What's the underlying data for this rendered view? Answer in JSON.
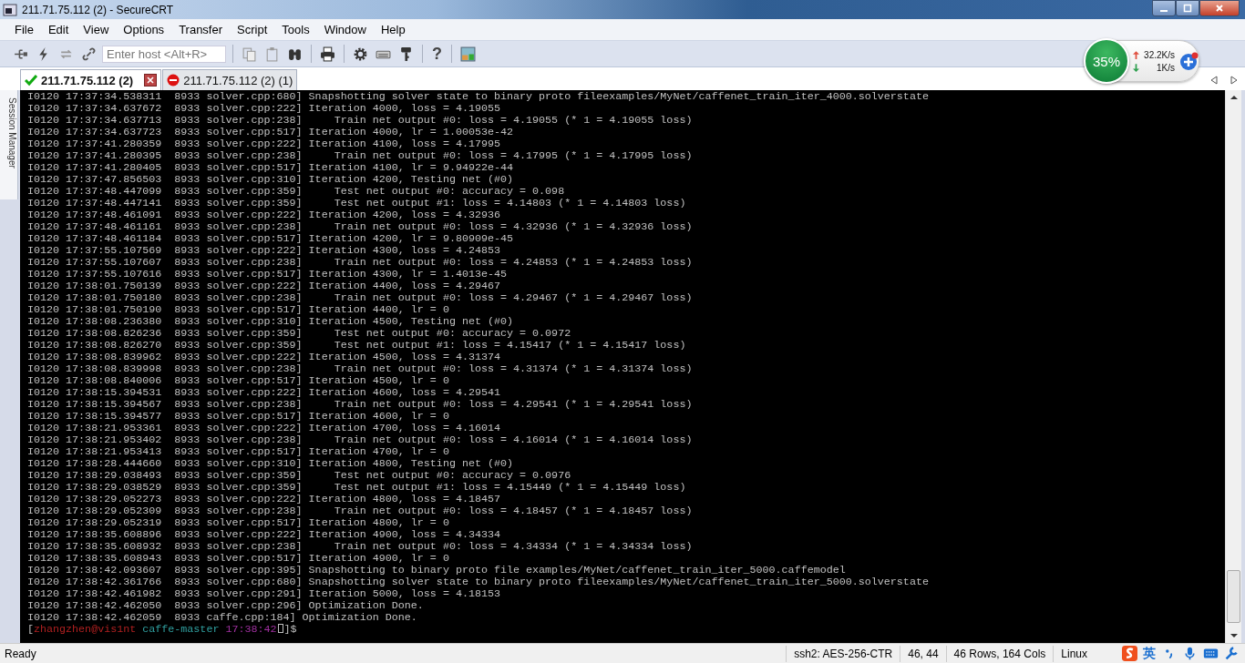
{
  "window": {
    "title": "211.71.75.112 (2) - SecureCRT"
  },
  "menu": [
    "File",
    "Edit",
    "View",
    "Options",
    "Transfer",
    "Script",
    "Tools",
    "Window",
    "Help"
  ],
  "toolbar": {
    "host_field": {
      "placeholder": "Enter host <Alt+R>"
    },
    "help_label": "?"
  },
  "tabs": [
    {
      "label": "211.71.75.112 (2)",
      "selected": true,
      "kind": "connected"
    },
    {
      "label": "211.71.75.112 (2) (1)",
      "selected": false,
      "kind": "disconnected"
    }
  ],
  "session_manager": {
    "label": "Session Manager"
  },
  "network_widget": {
    "percent": "35%",
    "upload": "32.2K/s",
    "download": "1K/s"
  },
  "terminal": {
    "lines": [
      "I0120 17:37:34.538311  8933 solver.cpp:680] Snapshotting solver state to binary proto fileexamples/MyNet/caffenet_train_iter_4000.solverstate",
      "I0120 17:37:34.637672  8933 solver.cpp:222] Iteration 4000, loss = 4.19055",
      "I0120 17:37:34.637713  8933 solver.cpp:238]     Train net output #0: loss = 4.19055 (* 1 = 4.19055 loss)",
      "I0120 17:37:34.637723  8933 solver.cpp:517] Iteration 4000, lr = 1.00053e-42",
      "I0120 17:37:41.280359  8933 solver.cpp:222] Iteration 4100, loss = 4.17995",
      "I0120 17:37:41.280395  8933 solver.cpp:238]     Train net output #0: loss = 4.17995 (* 1 = 4.17995 loss)",
      "I0120 17:37:41.280405  8933 solver.cpp:517] Iteration 4100, lr = 9.94922e-44",
      "I0120 17:37:47.856503  8933 solver.cpp:310] Iteration 4200, Testing net (#0)",
      "I0120 17:37:48.447099  8933 solver.cpp:359]     Test net output #0: accuracy = 0.098",
      "I0120 17:37:48.447141  8933 solver.cpp:359]     Test net output #1: loss = 4.14803 (* 1 = 4.14803 loss)",
      "I0120 17:37:48.461091  8933 solver.cpp:222] Iteration 4200, loss = 4.32936",
      "I0120 17:37:48.461161  8933 solver.cpp:238]     Train net output #0: loss = 4.32936 (* 1 = 4.32936 loss)",
      "I0120 17:37:48.461184  8933 solver.cpp:517] Iteration 4200, lr = 9.80909e-45",
      "I0120 17:37:55.107569  8933 solver.cpp:222] Iteration 4300, loss = 4.24853",
      "I0120 17:37:55.107607  8933 solver.cpp:238]     Train net output #0: loss = 4.24853 (* 1 = 4.24853 loss)",
      "I0120 17:37:55.107616  8933 solver.cpp:517] Iteration 4300, lr = 1.4013e-45",
      "I0120 17:38:01.750139  8933 solver.cpp:222] Iteration 4400, loss = 4.29467",
      "I0120 17:38:01.750180  8933 solver.cpp:238]     Train net output #0: loss = 4.29467 (* 1 = 4.29467 loss)",
      "I0120 17:38:01.750190  8933 solver.cpp:517] Iteration 4400, lr = 0",
      "I0120 17:38:08.236380  8933 solver.cpp:310] Iteration 4500, Testing net (#0)",
      "I0120 17:38:08.826236  8933 solver.cpp:359]     Test net output #0: accuracy = 0.0972",
      "I0120 17:38:08.826270  8933 solver.cpp:359]     Test net output #1: loss = 4.15417 (* 1 = 4.15417 loss)",
      "I0120 17:38:08.839962  8933 solver.cpp:222] Iteration 4500, loss = 4.31374",
      "I0120 17:38:08.839998  8933 solver.cpp:238]     Train net output #0: loss = 4.31374 (* 1 = 4.31374 loss)",
      "I0120 17:38:08.840006  8933 solver.cpp:517] Iteration 4500, lr = 0",
      "I0120 17:38:15.394531  8933 solver.cpp:222] Iteration 4600, loss = 4.29541",
      "I0120 17:38:15.394567  8933 solver.cpp:238]     Train net output #0: loss = 4.29541 (* 1 = 4.29541 loss)",
      "I0120 17:38:15.394577  8933 solver.cpp:517] Iteration 4600, lr = 0",
      "I0120 17:38:21.953361  8933 solver.cpp:222] Iteration 4700, loss = 4.16014",
      "I0120 17:38:21.953402  8933 solver.cpp:238]     Train net output #0: loss = 4.16014 (* 1 = 4.16014 loss)",
      "I0120 17:38:21.953413  8933 solver.cpp:517] Iteration 4700, lr = 0",
      "I0120 17:38:28.444660  8933 solver.cpp:310] Iteration 4800, Testing net (#0)",
      "I0120 17:38:29.038493  8933 solver.cpp:359]     Test net output #0: accuracy = 0.0976",
      "I0120 17:38:29.038529  8933 solver.cpp:359]     Test net output #1: loss = 4.15449 (* 1 = 4.15449 loss)",
      "I0120 17:38:29.052273  8933 solver.cpp:222] Iteration 4800, loss = 4.18457",
      "I0120 17:38:29.052309  8933 solver.cpp:238]     Train net output #0: loss = 4.18457 (* 1 = 4.18457 loss)",
      "I0120 17:38:29.052319  8933 solver.cpp:517] Iteration 4800, lr = 0",
      "I0120 17:38:35.608896  8933 solver.cpp:222] Iteration 4900, loss = 4.34334",
      "I0120 17:38:35.608932  8933 solver.cpp:238]     Train net output #0: loss = 4.34334 (* 1 = 4.34334 loss)",
      "I0120 17:38:35.608943  8933 solver.cpp:517] Iteration 4900, lr = 0",
      "I0120 17:38:42.093607  8933 solver.cpp:395] Snapshotting to binary proto file examples/MyNet/caffenet_train_iter_5000.caffemodel",
      "I0120 17:38:42.361766  8933 solver.cpp:680] Snapshotting solver state to binary proto fileexamples/MyNet/caffenet_train_iter_5000.solverstate",
      "I0120 17:38:42.461982  8933 solver.cpp:291] Iteration 5000, loss = 4.18153",
      "I0120 17:38:42.462050  8933 solver.cpp:296] Optimization Done.",
      "I0120 17:38:42.462059  8933 caffe.cpp:184] Optimization Done."
    ],
    "prompt": [
      {
        "text": "["
      },
      {
        "text": "zhangzhen@vis1nt",
        "color": "#b02020"
      },
      {
        "text": " caffe-master",
        "color": "#30a0a0"
      },
      {
        "text": " 17:38:42",
        "color": "#a030a0"
      },
      {
        "kind": "cursor"
      },
      {
        "text": "]$"
      }
    ]
  },
  "status_bar": {
    "left": "Ready",
    "cells": [
      "ssh2: AES-256-CTR",
      "46,  44",
      "46 Rows, 164 Cols",
      "Linux"
    ],
    "ime_label": "英"
  }
}
